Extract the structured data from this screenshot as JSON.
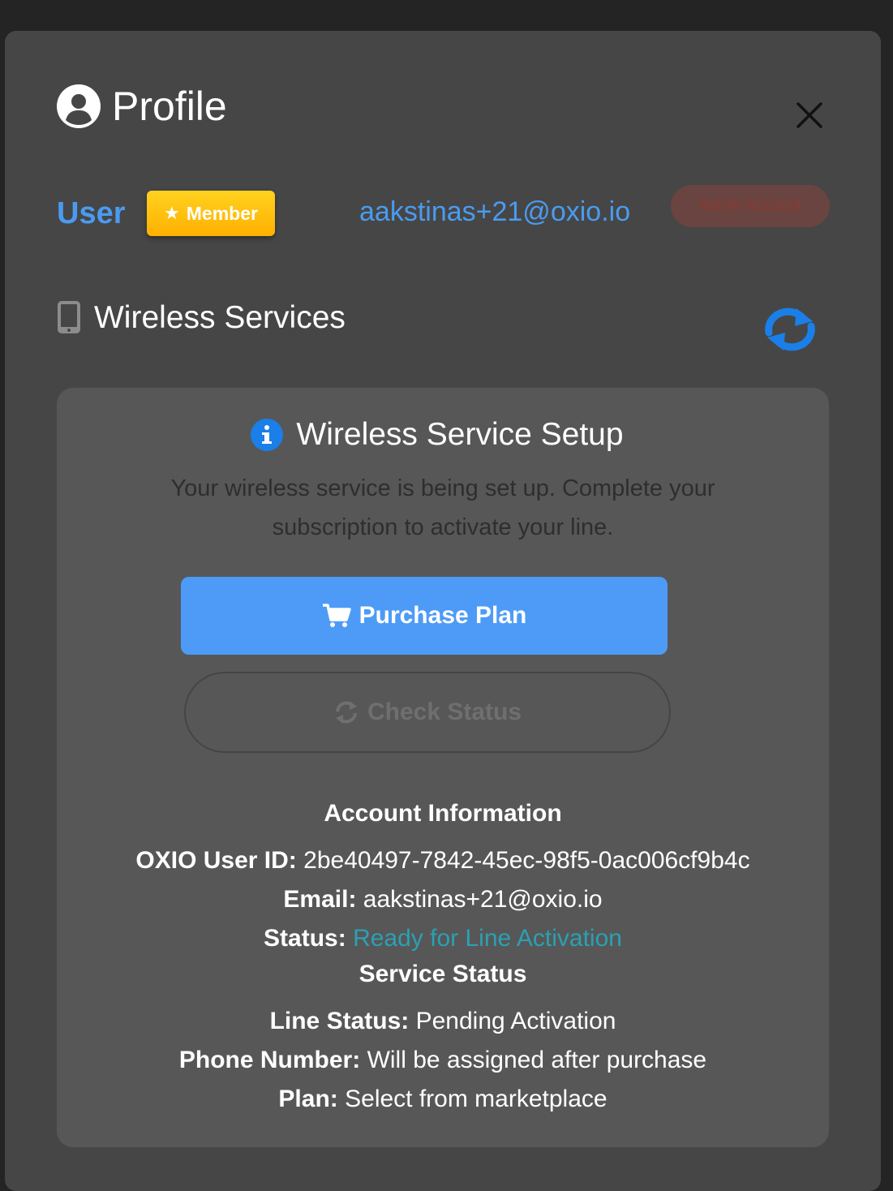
{
  "header": {
    "title": "Profile",
    "icon": "user-circle-icon",
    "close_icon": "close-icon"
  },
  "user": {
    "label": "User",
    "badge": "Member",
    "badge_icon": "star-icon",
    "email": "aakstinas+21@oxio.io",
    "admin_label": "Admin Account"
  },
  "wireless": {
    "title": "Wireless Services",
    "icon": "mobile-phone-icon",
    "refresh_icon": "refresh-icon"
  },
  "setup": {
    "title": "Wireless Service Setup",
    "icon": "info-circle-icon",
    "description": "Your wireless service is being set up. Complete your subscription to activate your line.",
    "purchase_label": "Purchase Plan",
    "check_label": "Check Status"
  },
  "account": {
    "title": "Account Information",
    "user_id_label": "OXIO User ID:",
    "user_id_value": "2be40497-7842-45ec-98f5-0ac006cf9b4c",
    "email_label": "Email:",
    "email_value": "aakstinas+21@oxio.io",
    "status_label": "Status:",
    "status_value": "Ready for Line Activation"
  },
  "service": {
    "title": "Service Status",
    "line_status_label": "Line Status:",
    "line_status_value": "Pending Activation",
    "phone_label": "Phone Number:",
    "phone_value": "Will be assigned after purchase",
    "plan_label": "Plan:",
    "plan_value": "Select from marketplace"
  },
  "colors": {
    "accent": "#4a9bf0",
    "button_blue": "#4d9bf7",
    "badge_gold": "#ffc107",
    "status_teal": "#2aa1b3",
    "admin_red": "#8a3a32"
  }
}
